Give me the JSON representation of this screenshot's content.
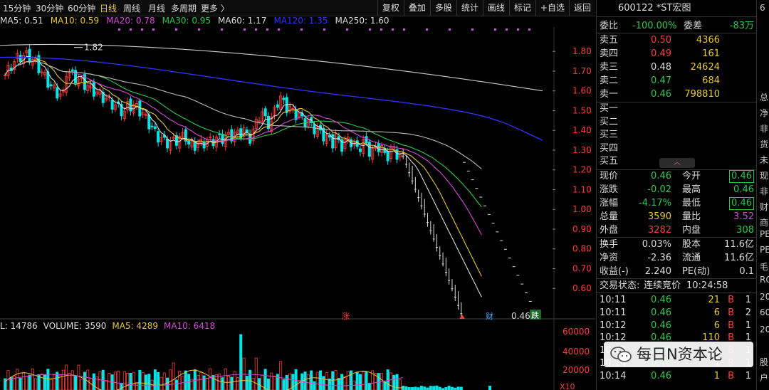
{
  "toolbar": {
    "timeframes": [
      {
        "label": "15分钟",
        "active": false
      },
      {
        "label": "30分钟",
        "active": false
      },
      {
        "label": "60分钟",
        "active": false
      },
      {
        "label": "日线",
        "active": true
      },
      {
        "label": "周线",
        "active": false
      },
      {
        "label": "月线",
        "active": false
      },
      {
        "label": "多周期",
        "active": false
      },
      {
        "label": "更多 〉",
        "active": false
      }
    ],
    "right_buttons": [
      "复权",
      "叠加",
      "多股",
      "统计",
      "画线",
      "标记",
      "+自选",
      "返回"
    ]
  },
  "ma_legend": [
    {
      "label": "MA5: 0.51",
      "color": "#dddddd"
    },
    {
      "label": "MA10: 0.59",
      "color": "#e6c83a"
    },
    {
      "label": "MA20: 0.78",
      "color": "#d04dd4"
    },
    {
      "label": "MA30: 0.95",
      "color": "#2ec74e"
    },
    {
      "label": "MA60: 1.17",
      "color": "#dddddd"
    },
    {
      "label": "MA120: 1.35",
      "color": "#3333ff"
    },
    {
      "label": "MA250: 1.60",
      "color": "#dddddd"
    }
  ],
  "volume_legend": [
    {
      "label": "L: 14786",
      "color": "#dddddd"
    },
    {
      "label": "VOLUME: 3590",
      "color": "#dddddd"
    },
    {
      "label": "MA5: 4289",
      "color": "#e6c83a"
    },
    {
      "label": "MA10: 6418",
      "color": "#d04dd4"
    }
  ],
  "chart_data": {
    "type": "candlestick",
    "price_axis": {
      "ticks": [
        "1.80",
        "1.70",
        "1.60",
        "1.50",
        "1.40",
        "1.30",
        "1.20",
        "1.10",
        "1.00",
        "0.90",
        "0.80",
        "0.70",
        "0.60"
      ],
      "ylim": [
        0.5,
        1.88
      ]
    },
    "volume_axis": {
      "ticks": [
        "60000",
        "40000",
        "20000"
      ],
      "unit": "X10"
    },
    "annotations": {
      "high": "1.82",
      "low": "0.46",
      "zhang": "涨",
      "cai": "财",
      "die": "跌"
    }
  },
  "panel": {
    "title": "600122 *ST宏图",
    "weibi": {
      "label": "委比",
      "value": "-100.00%",
      "label2": "委差",
      "value2": "-83万"
    },
    "sell": [
      {
        "label": "卖五",
        "price": "0.50",
        "vol": "4366",
        "color": "red"
      },
      {
        "label": "卖四",
        "price": "0.49",
        "vol": "161",
        "color": "red"
      },
      {
        "label": "卖三",
        "price": "0.48",
        "vol": "24624",
        "color": "white"
      },
      {
        "label": "卖二",
        "price": "0.47",
        "vol": "684",
        "color": "green"
      },
      {
        "label": "卖一",
        "price": "0.46",
        "vol": "798810",
        "color": "green"
      }
    ],
    "buy": [
      {
        "label": "买一"
      },
      {
        "label": "买二"
      },
      {
        "label": "买三"
      },
      {
        "label": "买四"
      },
      {
        "label": "买五"
      }
    ],
    "collapse_icon": "︿",
    "stats": [
      {
        "l1": "现价",
        "v1": "0.46",
        "c1": "green",
        "l2": "今开",
        "v2": "0.46",
        "c2": "green",
        "box": true
      },
      {
        "l1": "涨跌",
        "v1": "-0.02",
        "c1": "green",
        "l2": "最高",
        "v2": "0.46",
        "c2": "green",
        "box": false
      },
      {
        "l1": "涨幅",
        "v1": "-4.17%",
        "c1": "green",
        "l2": "最低",
        "v2": "0.46",
        "c2": "green",
        "box": true
      },
      {
        "l1": "总量",
        "v1": "3590",
        "c1": "yellow",
        "l2": "量比",
        "v2": "3.52",
        "c2": "purple",
        "box": false
      },
      {
        "l1": "外盘",
        "v1": "3282",
        "c1": "red",
        "l2": "内盘",
        "v2": "308",
        "c2": "green",
        "box": false
      }
    ],
    "stats2": [
      {
        "l1": "换手",
        "v1": "0.03%",
        "l2": "股本",
        "v2": "11.6亿"
      },
      {
        "l1": "净资",
        "v1": "-2.36",
        "l2": "流通",
        "v2": "11.6亿"
      },
      {
        "l1": "收益(-)",
        "v1": "2.240",
        "l2": "PE(动)",
        "v2": "0.1"
      }
    ],
    "status": {
      "label": "交易状态:",
      "value": "连续竞价",
      "time": "10:24:58"
    },
    "trades": [
      {
        "t": "10:11",
        "p": "0.46",
        "v": "21",
        "s": "B",
        "n": "1"
      },
      {
        "t": "10:11",
        "p": "0.46",
        "v": "6",
        "s": "B",
        "n": "2"
      },
      {
        "t": "10:12",
        "p": "0.46",
        "v": "6",
        "s": "B",
        "n": "1"
      },
      {
        "t": "10:12",
        "p": "0.46",
        "v": "110",
        "s": "B",
        "n": "1"
      },
      {
        "t": "10:13",
        "p": "0.46",
        "v": "1",
        "s": "B",
        "n": "1"
      },
      {
        "t": "10:14",
        "p": "0.46",
        "v": "1",
        "s": "B",
        "n": "1"
      },
      {
        "t": "10:14",
        "p": "0.46",
        "v": "1",
        "s": "B",
        "n": "1"
      }
    ]
  },
  "edge_chars": [
    "6",
    "总",
    "净",
    "非",
    "货",
    "未",
    "现",
    "非",
    "财",
    "商",
    "PE",
    "PE",
    "毛",
    "RO",
    "20",
    "60",
    "20",
    "股",
    "户"
  ],
  "watermark": {
    "text": "每日N资本论",
    "icon": "wechat-icon"
  }
}
